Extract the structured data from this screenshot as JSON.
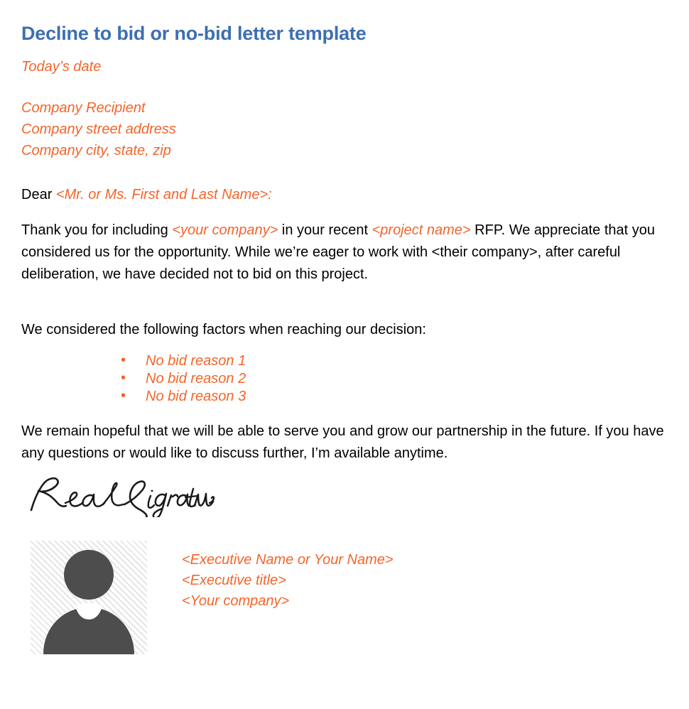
{
  "document": {
    "title": "Decline to bid or no-bid letter template",
    "date_placeholder": "Today’s date",
    "recipient_address": [
      "Company Recipient",
      "Company street address",
      "Company city, state, zip"
    ],
    "salutation": {
      "greeting": "Dear ",
      "name_placeholder": "<Mr. or Ms. First and Last Name>:"
    },
    "body_paragraph": {
      "segment_1": "Thank you for including ",
      "placeholder_1": "<your company>",
      "segment_2": " in your recent ",
      "placeholder_2": "<project name>",
      "segment_3": " RFP. We appreciate that you considered us for the opportunity. While we’re eager to work with <their company>, after careful deliberation, we have decided not to bid on this project."
    },
    "factors_lead_in": "We considered the following factors when reaching our decision:",
    "reasons": [
      "No bid reason 1",
      "No bid reason 2",
      "No bid reason 3"
    ],
    "closing_paragraph": "We remain hopeful that we will be able to serve you and grow our partnership in the future. If you have any questions or would like to discuss further, I’m available anytime.",
    "signature": {
      "alt_text": "Real Signature",
      "ink_color": "#1a1a1a"
    },
    "sign_off": {
      "avatar_alt": "person-placeholder-photo",
      "lines": [
        "<Executive Name or Your Name>",
        "<Executive title>",
        "<Your company>"
      ]
    },
    "colors": {
      "title_blue": "#3d6fb0",
      "placeholder_orange": "#f4652b",
      "body_black": "#000000",
      "avatar_silhouette": "#4d4d4d",
      "avatar_hatch": "#e6e6e6"
    }
  }
}
